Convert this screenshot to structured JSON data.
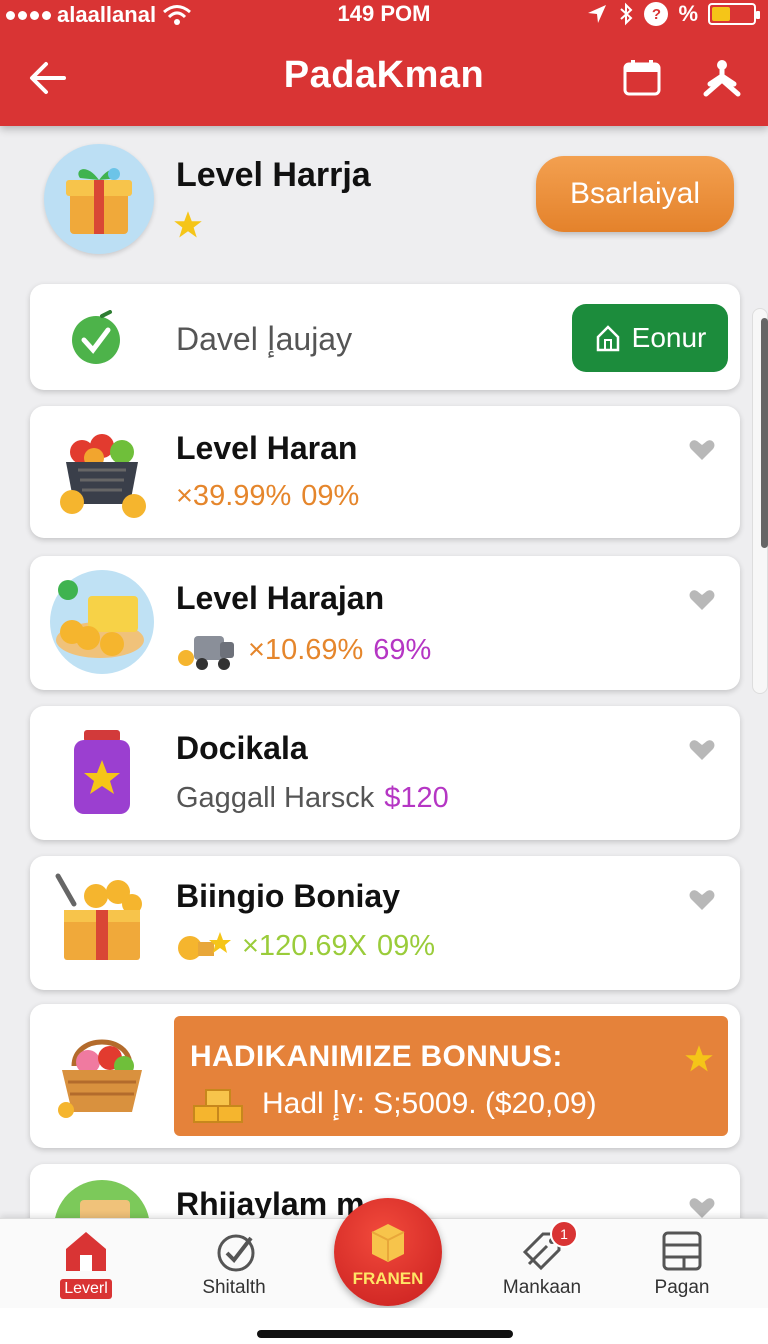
{
  "status_bar": {
    "carrier": "alaallanal",
    "time": "149 POM",
    "battery_text": "%",
    "battery_level": 0.45
  },
  "header": {
    "title": "PadaKman"
  },
  "level_header": {
    "title": "Level Harrja",
    "button_label": "Bsarlaiyal"
  },
  "daily": {
    "text": "Davel إaujay",
    "button_label": "Eonur"
  },
  "items": [
    {
      "title": "Level Haran",
      "sub_a": "×39.99%",
      "sub_b": "09%",
      "color_a": "#e5862c",
      "color_b": "#e5862c"
    },
    {
      "title": "Level Harajan",
      "sub_a": "×10.69%",
      "sub_b": "69%",
      "color_a": "#e5862c",
      "color_b": "#b536c4"
    },
    {
      "title": "Docikala",
      "sub_a": "Gaggall Harsck",
      "sub_b": "$120",
      "color_a": "#555555",
      "color_b": "#b536c4"
    },
    {
      "title": "Biingio Boniay",
      "sub_a": "×120.69X",
      "sub_b": "09%",
      "color_a": "#9acc3a",
      "color_b": "#9acc3a"
    }
  ],
  "bonus": {
    "title": "HADIKANIMIZE BONNUS:",
    "text": "Hadl ٧إ: S;5009. ($20,09)"
  },
  "partial_item": {
    "title": "Rhijaylam m"
  },
  "bottom_nav": {
    "items": [
      {
        "label": "Leverl"
      },
      {
        "label": "Shitalth"
      },
      {
        "label": "FRANEN"
      },
      {
        "label": "Mankaan",
        "badge": "1"
      },
      {
        "label": "Pagan"
      }
    ]
  },
  "colors": {
    "header": "#d93434",
    "accent_orange": "#e5823a",
    "accent_green": "#1c8c3c"
  }
}
